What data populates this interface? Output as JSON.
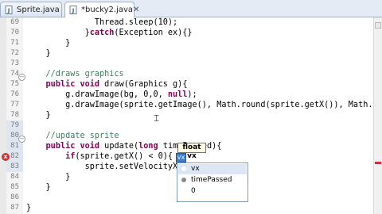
{
  "tabs": [
    {
      "label": "Sprite.java",
      "close": "",
      "active": false
    },
    {
      "label": "*bucky2.java",
      "close": "✕",
      "active": true
    }
  ],
  "code_lines": [
    {
      "num": "69",
      "tokens": [
        {
          "t": "              Thread.sleep(10);",
          "c": ""
        }
      ]
    },
    {
      "num": "70",
      "tokens": [
        {
          "t": "            }",
          "c": ""
        },
        {
          "t": "catch",
          "c": "kw"
        },
        {
          "t": "(Exception ex){}",
          "c": ""
        }
      ]
    },
    {
      "num": "71",
      "tokens": [
        {
          "t": "        }",
          "c": ""
        }
      ]
    },
    {
      "num": "72",
      "tokens": [
        {
          "t": "    }",
          "c": ""
        }
      ]
    },
    {
      "num": "73",
      "tokens": [
        {
          "t": "",
          "c": ""
        }
      ]
    },
    {
      "num": "74",
      "tokens": [
        {
          "t": "    //draws graphics",
          "c": "cm"
        }
      ]
    },
    {
      "num": "75",
      "tokens": [
        {
          "t": "    ",
          "c": ""
        },
        {
          "t": "public",
          "c": "kw"
        },
        {
          "t": " ",
          "c": ""
        },
        {
          "t": "void",
          "c": "kw"
        },
        {
          "t": " draw(Graphics g){",
          "c": ""
        }
      ]
    },
    {
      "num": "76",
      "tokens": [
        {
          "t": "        g.drawImage(bg, 0,0, ",
          "c": ""
        },
        {
          "t": "null",
          "c": "kw"
        },
        {
          "t": ");",
          "c": ""
        }
      ]
    },
    {
      "num": "77",
      "tokens": [
        {
          "t": "        g.drawImage(sprite.getImage(), Math.round(sprite.getX()), Math.r",
          "c": ""
        }
      ]
    },
    {
      "num": "78",
      "tokens": [
        {
          "t": "    }",
          "c": ""
        }
      ]
    },
    {
      "num": "79",
      "tokens": [
        {
          "t": "",
          "c": ""
        }
      ]
    },
    {
      "num": "80",
      "tokens": [
        {
          "t": "    //update sprite",
          "c": "cm"
        }
      ]
    },
    {
      "num": "81",
      "tokens": [
        {
          "t": "    ",
          "c": ""
        },
        {
          "t": "public",
          "c": "kw"
        },
        {
          "t": " ",
          "c": ""
        },
        {
          "t": "void",
          "c": "kw"
        },
        {
          "t": " update(",
          "c": ""
        },
        {
          "t": "long",
          "c": "kw"
        },
        {
          "t": " timePassed){",
          "c": ""
        }
      ]
    },
    {
      "num": "82",
      "tokens": [
        {
          "t": "        ",
          "c": ""
        },
        {
          "t": "if",
          "c": "kw"
        },
        {
          "t": "(sprite.getX() < 0){",
          "c": ""
        }
      ]
    },
    {
      "num": "83",
      "tokens": [
        {
          "t": "            sprite.setVelocityX(",
          "c": ""
        }
      ]
    },
    {
      "num": "84",
      "tokens": [
        {
          "t": "        }",
          "c": ""
        }
      ]
    },
    {
      "num": "85",
      "tokens": [
        {
          "t": "    }",
          "c": ""
        }
      ]
    },
    {
      "num": "86",
      "tokens": [
        {
          "t": "",
          "c": ""
        }
      ]
    },
    {
      "num": "87",
      "tokens": [
        {
          "t": "}",
          "c": ""
        }
      ]
    }
  ],
  "fold_marker": "−",
  "error_marker_glyph": "x",
  "param_hint": "float vx",
  "selected_arg": "vx",
  "content_assist": [
    {
      "label": "vx",
      "icon_color": "#ffffff"
    },
    {
      "label": "timePassed",
      "icon_color": "#8a8a8a"
    },
    {
      "label": "0",
      "icon_color": "#ffffff"
    }
  ],
  "cursor_glyph": "⌶",
  "colors": {
    "keyword": "#7f0055",
    "comment": "#3f7f5f",
    "error": "#d03030",
    "selection": "#3c7dd0"
  }
}
